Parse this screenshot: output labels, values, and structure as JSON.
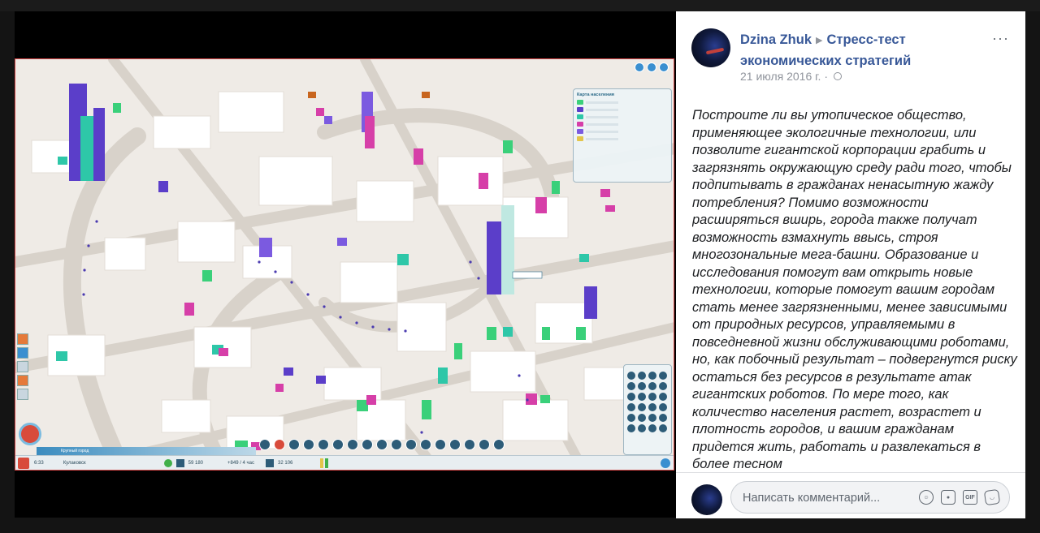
{
  "post": {
    "author": "Dzina Zhuk",
    "group": "Стресс-тест экономических стратегий",
    "date": "21 июля 2016 г. ·",
    "text": "Построите ли вы утопическое общество, применяющее экологичные технологии, или позволите гигантской корпорации грабить и загрязнять окружающую среду ради того, чтобы подпитывать в гражданах ненасытную жажду потребления? Помимо возможности расширяться вширь, города также получат возможность взмахнуть ввысь, строя многозональные мега-башни. Образование и исследования помогут вам открыть новые технологии, которые помогут вашим городам стать менее загрязненными, менее зависимыми от природных ресурсов, управляемыми в повседневной жизни обслуживающими роботами, но, как побочный результат – подвергнутся риску остаться без ресурсов в результате атак гигантских роботов. По мере того, как количество населения растет, возрастет и плотность городов, и вашим гражданам придется жить, работать и развлекаться в более тесном",
    "icons": {
      "arrow": "right-triangle-icon",
      "privacy": "globe-icon",
      "more": "more-icon"
    }
  },
  "comment": {
    "placeholder": "Написать комментарий...",
    "icons": [
      "emoji-icon",
      "camera-icon",
      "gif-icon",
      "sticker-icon"
    ],
    "gif_label": "GIF"
  },
  "game": {
    "population_panel_title": "Карта населения",
    "city_name_bar": "Крупный город",
    "status": {
      "time": "6:33",
      "city": "Кулаковск",
      "money": "59 180",
      "income": "+849 / 4 час",
      "population": "32 106"
    }
  },
  "colors": {
    "link": "#385898",
    "muted": "#90949c",
    "game_border": "#d24545",
    "population_purple": "#5b3ec9",
    "population_teal": "#2ec7a8",
    "population_magenta": "#d63fa8"
  }
}
